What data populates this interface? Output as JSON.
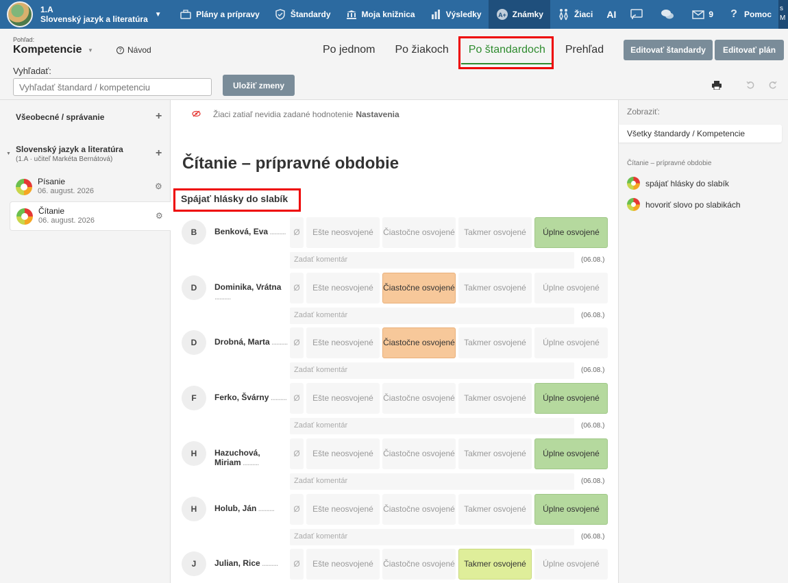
{
  "topbar": {
    "class_name": "1.A",
    "subject": "Slovenský jazyk a literatúra",
    "nav": [
      {
        "label": "Plány a prípravy",
        "icon": "briefcase-icon"
      },
      {
        "label": "Štandardy",
        "icon": "shield-check-icon"
      },
      {
        "label": "Moja knižnica",
        "icon": "library-icon"
      },
      {
        "label": "Výsledky",
        "icon": "bar-chart-icon"
      },
      {
        "label": "Známky",
        "icon": "grades-icon",
        "active": true
      },
      {
        "label": "Žiaci",
        "icon": "students-icon"
      },
      {
        "label": "AI",
        "icon": ""
      },
      {
        "label": "",
        "icon": "cast-icon"
      },
      {
        "label": "",
        "icon": "chat-icon"
      },
      {
        "label": "9",
        "icon": "mail-icon"
      },
      {
        "label": "Pomoc",
        "icon": "question-icon"
      }
    ],
    "edge_text": "s\nM"
  },
  "toolbar": {
    "view_label": "Pohľad:",
    "view_value": "Kompetencie",
    "help_label": "Návod",
    "tabs": [
      "Po jednom",
      "Po žiakoch",
      "Po štandardoch",
      "Prehľad"
    ],
    "active_tab": "Po štandardoch",
    "edit_standards": "Editovať štandardy",
    "edit_plan": "Editovať plán",
    "search_label": "Vyhľadať:",
    "search_placeholder": "Vyhľadať štandard / kompetenciu",
    "save_label": "Uložiť zmeny"
  },
  "left": {
    "section1": "Všeobecné / správanie",
    "section2": "Slovenský jazyk a literatúra",
    "section2_sub": "(1.A · učiteľ Markéta Bernátová)",
    "items": [
      {
        "title": "Písanie",
        "date": "06. august. 2026"
      },
      {
        "title": "Čítanie",
        "date": "06. august. 2026"
      }
    ]
  },
  "main": {
    "notice_text": "Žiaci zatiaľ nevidia zadané hodnotenie",
    "notice_link": "Nastavenia",
    "title": "Čítanie – prípravné obdobie",
    "subtitle": "Spájať hlásky do slabík",
    "levels": {
      "zero": "Ø",
      "l1": "Ešte neosvojené",
      "l2": "Čiastočne osvojené",
      "l3": "Takmer osvojené",
      "l4": "Úplne osvojené"
    },
    "comment_placeholder": "Zadať komentár",
    "comment_date": "(06.08.)",
    "students": [
      {
        "initial": "B",
        "name": "Benková, Eva",
        "grade": "l4"
      },
      {
        "initial": "D",
        "name": "Dominika, Vrátna",
        "grade": "l2"
      },
      {
        "initial": "D",
        "name": "Drobná, Marta",
        "grade": "l2"
      },
      {
        "initial": "F",
        "name": "Ferko, Švárny",
        "grade": "l4"
      },
      {
        "initial": "H",
        "name": "Hazuchová, Miriam",
        "grade": "l4"
      },
      {
        "initial": "H",
        "name": "Holub, Ján",
        "grade": "l4"
      },
      {
        "initial": "J",
        "name": "Julian, Rice",
        "grade": "l3"
      }
    ]
  },
  "right": {
    "label": "Zobraziť:",
    "selected": "Všetky štandardy / Kompetencie",
    "group": "Čítanie – prípravné obdobie",
    "items": [
      "spájať hlásky do slabík",
      "hovoriť slovo po slabikách"
    ]
  }
}
